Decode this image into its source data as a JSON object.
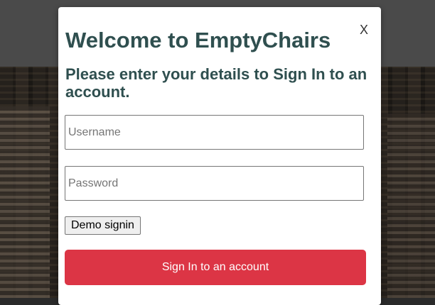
{
  "modal": {
    "close_label": "X",
    "title": "Welcome to EmptyChairs",
    "subtitle": "Please enter your details to Sign In to an account.",
    "username": {
      "placeholder": "Username",
      "value": ""
    },
    "password": {
      "placeholder": "Password",
      "value": ""
    },
    "demo_button_label": "Demo signin",
    "signin_button_label": "Sign In to an account"
  },
  "colors": {
    "title": "#2f4f4f",
    "signin_button": "#dc3545",
    "backdrop": "#4a4a4a"
  }
}
